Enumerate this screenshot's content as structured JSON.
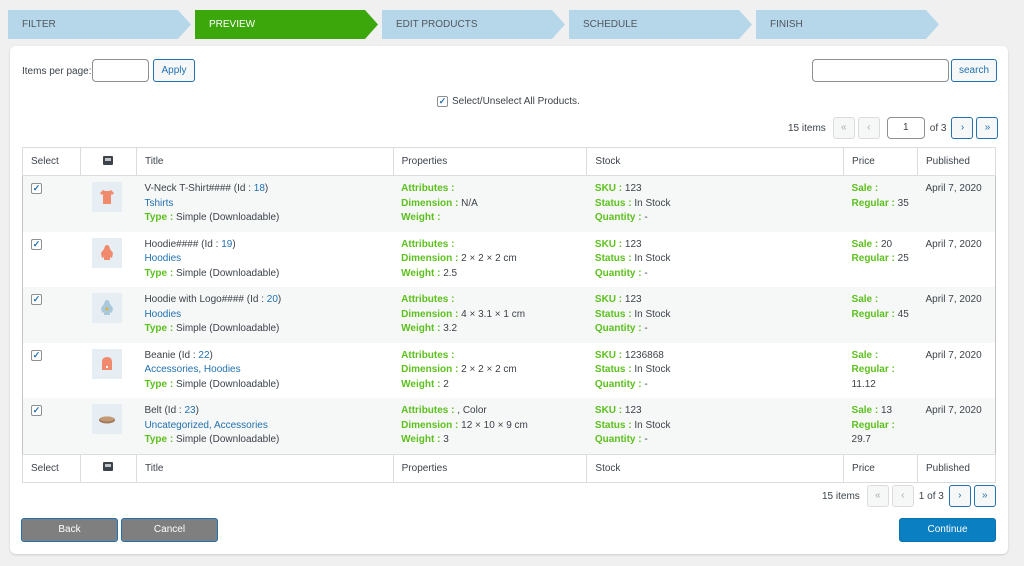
{
  "steps": [
    {
      "label": "FILTER",
      "active": false
    },
    {
      "label": "PREVIEW",
      "active": true
    },
    {
      "label": "EDIT PRODUCTS",
      "active": false
    },
    {
      "label": "SCHEDULE",
      "active": false
    },
    {
      "label": "FINISH",
      "active": false
    }
  ],
  "toolbar": {
    "items_per_page_label": "Items per page:",
    "items_per_page_value": "",
    "apply_label": "Apply",
    "search_value": "",
    "search_label": "search",
    "select_all_label": "Select/Unselect All Products.",
    "select_all_checked": true
  },
  "pagination_top": {
    "items_count": "15 items",
    "first": "«",
    "prev": "‹",
    "current_page": "1",
    "of_total": "of 3",
    "next": "›",
    "last": "»"
  },
  "pagination_bottom": {
    "items_count": "15 items",
    "first": "«",
    "prev": "‹",
    "page_text": "1 of 3",
    "next": "›",
    "last": "»"
  },
  "table": {
    "columns": [
      "Select",
      "image-icon",
      "Title",
      "Properties",
      "Stock",
      "Price",
      "Published"
    ],
    "labels": {
      "id": "Id :",
      "type": "Type :",
      "attributes": "Attributes :",
      "dimension": "Dimension :",
      "weight": "Weight :",
      "sku": "SKU :",
      "status": "Status :",
      "quantity": "Quantity :",
      "sale": "Sale :",
      "regular": "Regular :"
    },
    "rows": [
      {
        "checked": true,
        "thumb": "tshirt",
        "name": "V-Neck T-Shirt####",
        "id": "18",
        "categories": "Tshirts",
        "type": "Simple (Downloadable)",
        "attributes": "",
        "dimension": "N/A",
        "weight": "",
        "sku": "123",
        "status": "In Stock",
        "quantity": "-",
        "sale": "",
        "regular": "35",
        "published": "April 7, 2020"
      },
      {
        "checked": true,
        "thumb": "hoodie",
        "name": "Hoodie####",
        "id": "19",
        "categories": "Hoodies",
        "type": "Simple (Downloadable)",
        "attributes": "",
        "dimension": "2 × 2 × 2 cm",
        "weight": "2.5",
        "sku": "123",
        "status": "In Stock",
        "quantity": "-",
        "sale": "20",
        "regular": "25",
        "published": "April 7, 2020"
      },
      {
        "checked": true,
        "thumb": "hoodie-logo",
        "name": "Hoodie with Logo####",
        "id": "20",
        "categories": "Hoodies",
        "type": "Simple (Downloadable)",
        "attributes": "",
        "dimension": "4 × 3.1 × 1 cm",
        "weight": "3.2",
        "sku": "123",
        "status": "In Stock",
        "quantity": "-",
        "sale": "",
        "regular": "45",
        "published": "April 7, 2020"
      },
      {
        "checked": true,
        "thumb": "beanie",
        "name": "Beanie",
        "id": "22",
        "categories": "Accessories, Hoodies",
        "type": "Simple (Downloadable)",
        "attributes": "",
        "dimension": "2 × 2 × 2 cm",
        "weight": "2",
        "sku": "1236868",
        "status": "In Stock",
        "quantity": "-",
        "sale": "",
        "regular": "11.12",
        "published": "April 7, 2020"
      },
      {
        "checked": true,
        "thumb": "belt",
        "name": "Belt",
        "id": "23",
        "categories": "Uncategorized, Accessories",
        "type": "Simple (Downloadable)",
        "attributes": ", Color",
        "dimension": "12 × 10 × 9 cm",
        "weight": "3",
        "sku": "123",
        "status": "In Stock",
        "quantity": "-",
        "sale": "13",
        "regular": "29.7",
        "published": "April 7, 2020"
      }
    ]
  },
  "footer": {
    "back_label": "Back",
    "cancel_label": "Cancel",
    "continue_label": "Continue"
  },
  "colors": {
    "active_step": "#3ca70a",
    "inactive_step": "#b6d7ea",
    "label_green": "#5cc11d",
    "link_blue": "#2271b1",
    "primary_button": "#0a7fc2",
    "secondary_button": "#7f7f7f"
  }
}
